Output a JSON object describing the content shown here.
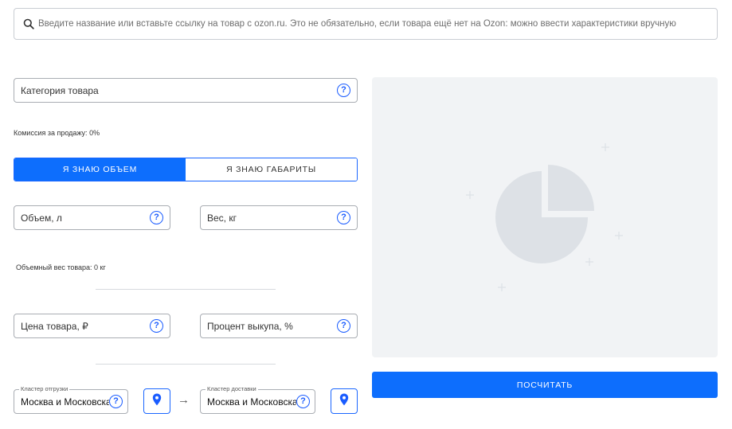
{
  "search": {
    "placeholder": "Введите название или вставьте ссылку на товар с ozon.ru. Это не обязательно, если товара ещё нет на Ozon: можно ввести характеристики вручную"
  },
  "category": {
    "placeholder": "Категория товара"
  },
  "commission": {
    "text": "Комиссия за продажу: 0%"
  },
  "toggle": {
    "volume_label": "Я ЗНАЮ ОБЪЕМ",
    "dimensions_label": "Я ЗНАЮ ГАБАРИТЫ",
    "active": "volume"
  },
  "volume": {
    "placeholder": "Объем, л"
  },
  "weight": {
    "placeholder": "Вес, кг"
  },
  "volumetric_weight": {
    "text": "Объемный вес товара: 0 кг"
  },
  "price": {
    "placeholder": "Цена товара, ₽"
  },
  "buyout": {
    "placeholder": "Процент выкупа, %"
  },
  "shipping_cluster": {
    "legend": "Кластер отгрузки",
    "value": "Москва и Московская область"
  },
  "delivery_cluster": {
    "legend": "Кластер доставки",
    "value": "Москва и Московская область"
  },
  "arrow": "→",
  "help_glyph": "?",
  "calculate": {
    "label": "ПОСЧИТАТЬ"
  },
  "colors": {
    "accent": "#0d6efd",
    "panel": "#f1f3f5",
    "placeholder_chart": "#e1e5e9"
  },
  "icons": {
    "search": "search-icon",
    "help": "help-icon",
    "pin": "map-pin-icon",
    "chart": "pie-chart-placeholder-icon"
  }
}
